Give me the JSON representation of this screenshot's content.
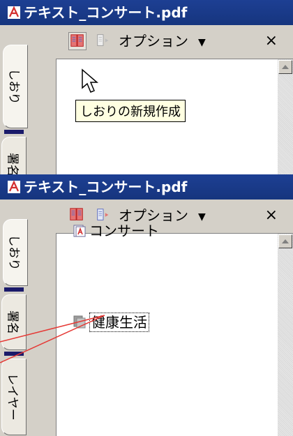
{
  "window1": {
    "title": "テキスト_コンサート.pdf",
    "tabs": [
      "しおり",
      "署名"
    ],
    "toolbar": {
      "options_label": "オプション",
      "caret": "▼",
      "close": "×"
    },
    "tooltip": "しおりの新規作成"
  },
  "window2": {
    "title": "テキスト_コンサート.pdf",
    "tabs": [
      "しおり",
      "署名",
      "レイヤー"
    ],
    "toolbar": {
      "options_label": "オプション",
      "caret": "▼",
      "close": "×"
    },
    "bookmarks": [
      {
        "label": "コンサート",
        "icon": "bookmark-doc-icon"
      },
      {
        "label": "健康生活",
        "icon": "bookmark-gray-icon"
      }
    ]
  },
  "colors": {
    "titlebar": "#1d3f93",
    "callout": "#e53935",
    "tooltip_bg": "#ffffe1"
  }
}
